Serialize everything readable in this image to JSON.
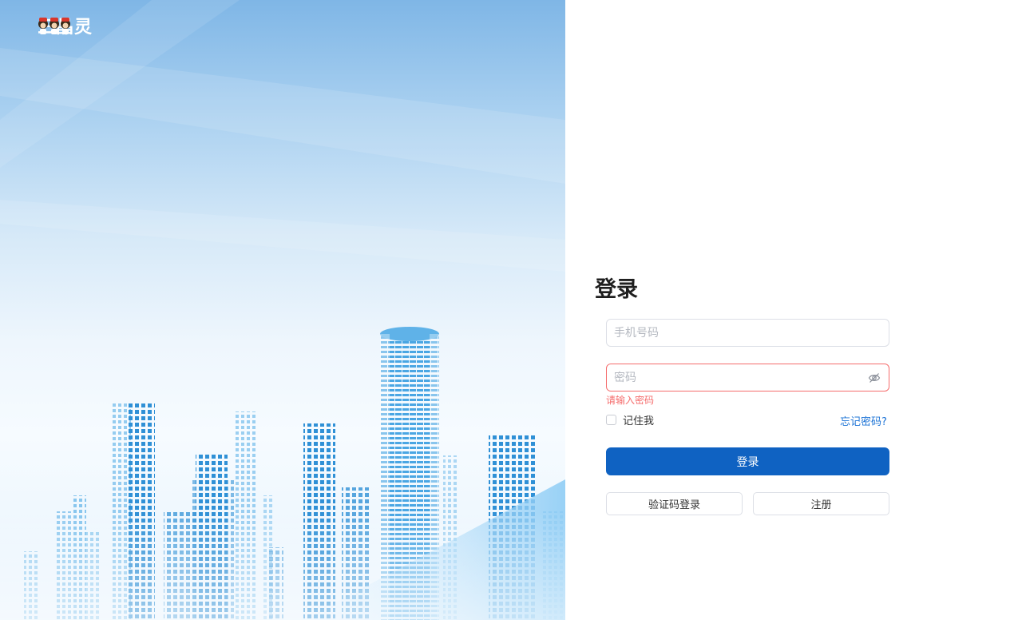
{
  "brand": {
    "name": "三晶灵",
    "logo_icon": "three-characters-logo-icon"
  },
  "hero": {
    "illustration": "city-skyline-illustration",
    "colors": {
      "sky_top": "#7fb6e6",
      "sky_mid": "#d6e9f8",
      "building": "#3a98d8"
    }
  },
  "login": {
    "title": "登录",
    "phone_placeholder": "手机号码",
    "phone_value": "",
    "password_placeholder": "密码",
    "password_value": "",
    "password_toggle_icon": "eye-off-icon",
    "password_error": "请输入密码",
    "remember_label": "记住我",
    "remember_checked": false,
    "forgot_label": "忘记密码?",
    "submit_label": "登录",
    "sms_login_label": "验证码登录",
    "register_label": "注册",
    "colors": {
      "primary": "#0f62c2",
      "error": "#f56c6c",
      "link": "#1e74d6"
    }
  }
}
